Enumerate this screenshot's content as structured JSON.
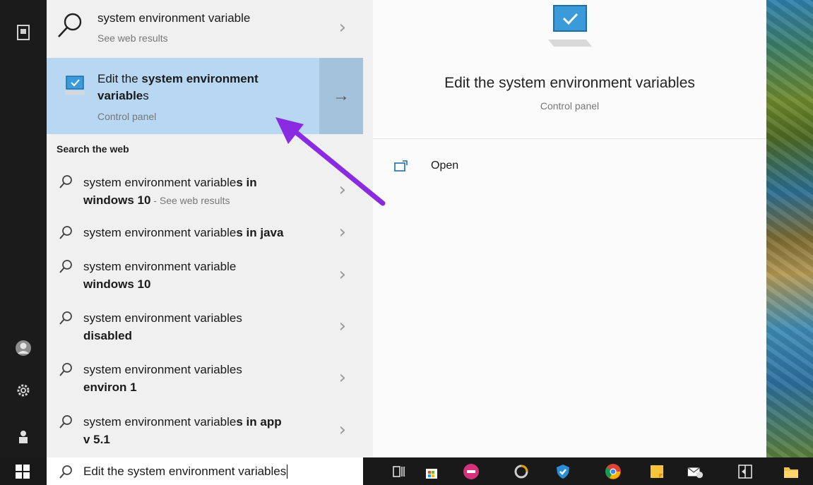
{
  "top_result": {
    "title": "system environment variable",
    "subtitle": "See web results"
  },
  "best_match": {
    "title_prefix": "Edit the ",
    "title_bold": "system environment variable",
    "title_suffix": "s",
    "subtitle": "Control panel"
  },
  "section_heading": "Search the web",
  "web_results": [
    {
      "normal": "system environment variable",
      "bold": "s in",
      "line2_bold": "windows 10",
      "line2_suffix": " - See web results"
    },
    {
      "normal": "system environment variable",
      "bold": "s in java"
    },
    {
      "normal": "system environment variable",
      "line2_bold": "windows 10"
    },
    {
      "normal": "system environment variables",
      "line2_bold": "disabled"
    },
    {
      "normal": "system environment variables",
      "line2_bold": "environ 1"
    },
    {
      "normal": "system environment variable",
      "bold": "s in app",
      "line2_bold": "v 5.1"
    }
  ],
  "preview": {
    "title": "Edit the system environment variables",
    "subtitle": "Control panel",
    "open_label": "Open"
  },
  "search": {
    "value": "Edit the system environment variables"
  },
  "colors": {
    "selection": "#b8d7f2",
    "selection_arrow_bg": "#a3c2dc",
    "annotation_arrow": "#8a2be2"
  },
  "icons": {
    "rail": [
      "document-icon",
      "user-avatar-icon",
      "settings-gear-icon",
      "power-user-icon",
      "windows-start-icon"
    ],
    "taskbar": [
      "task-view-icon",
      "store-icon",
      "app-pink-icon",
      "loading-circle-icon",
      "shield-icon",
      "chrome-icon",
      "sticky-notes-icon",
      "mail-icon",
      "remote-icon",
      "file-explorer-icon"
    ]
  }
}
